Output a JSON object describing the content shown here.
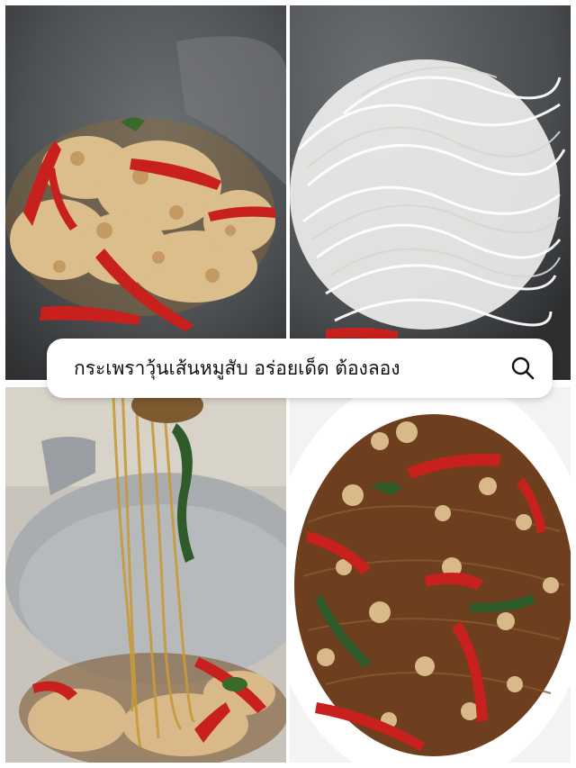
{
  "search": {
    "query": "กระเพราวุ้นเส้นหมูสับ อร่อยเด็ด ต้องลอง",
    "icon": "search-icon"
  },
  "photos": [
    {
      "id": "step-1",
      "subject": "stir-fried minced pork with red chili in wok"
    },
    {
      "id": "step-2",
      "subject": "soaked glass noodles added to wok"
    },
    {
      "id": "step-3",
      "subject": "glass noodles lifted from wok with basil"
    },
    {
      "id": "step-4",
      "subject": "finished spicy basil glass noodles on plate"
    }
  ],
  "colors": {
    "background": "#ffffff",
    "wok": "#5c5f62",
    "pork": "#d9b98a",
    "chili": "#c8201c",
    "noodle": "#f4f4f2",
    "basil": "#2f5a2a"
  }
}
